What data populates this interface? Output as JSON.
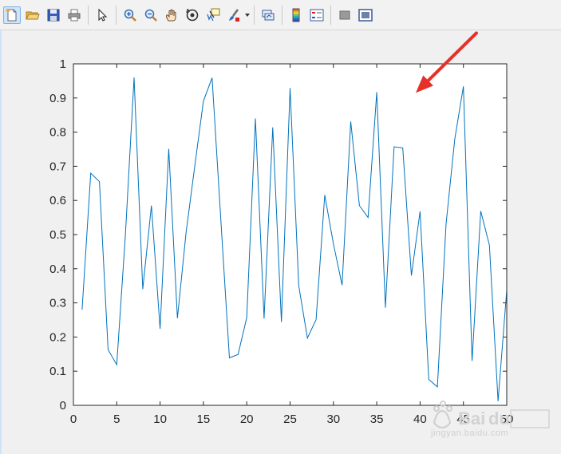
{
  "toolbar": {
    "buttons": [
      {
        "icon": "new-figure-icon"
      },
      {
        "icon": "open-file-icon"
      },
      {
        "icon": "save-icon"
      },
      {
        "icon": "print-icon"
      },
      {
        "icon": "edit-plot-arrow-icon"
      },
      {
        "icon": "zoom-in-icon"
      },
      {
        "icon": "zoom-out-icon"
      },
      {
        "icon": "pan-hand-icon"
      },
      {
        "icon": "rotate-3d-icon"
      },
      {
        "icon": "data-cursor-icon"
      },
      {
        "icon": "brush-icon"
      },
      {
        "icon": "link-plot-icon"
      },
      {
        "icon": "insert-colorbar-icon"
      },
      {
        "icon": "insert-legend-icon"
      },
      {
        "icon": "hide-plot-tools-icon"
      },
      {
        "icon": "show-plot-tools-icon"
      }
    ]
  },
  "colors": {
    "line": "#0072bd",
    "annotation_arrow": "#e8302a",
    "axes_background": "#ffffff",
    "figure_background": "#f0f0f0"
  },
  "chart_data": {
    "type": "line",
    "x": [
      1,
      2,
      3,
      4,
      5,
      6,
      7,
      8,
      9,
      10,
      11,
      12,
      13,
      14,
      15,
      16,
      17,
      18,
      19,
      20,
      21,
      22,
      23,
      24,
      25,
      26,
      27,
      28,
      29,
      30,
      31,
      32,
      33,
      34,
      35,
      36,
      37,
      38,
      39,
      40,
      41,
      42,
      43,
      44,
      45,
      46,
      47,
      48,
      49,
      50
    ],
    "series": [
      {
        "values": [
          0.28,
          0.68,
          0.655,
          0.163,
          0.119,
          0.5,
          0.96,
          0.34,
          0.585,
          0.224,
          0.751,
          0.255,
          0.506,
          0.7,
          0.891,
          0.959,
          0.547,
          0.139,
          0.149,
          0.257,
          0.84,
          0.254,
          0.814,
          0.244,
          0.929,
          0.35,
          0.197,
          0.251,
          0.616,
          0.473,
          0.352,
          0.831,
          0.585,
          0.55,
          0.917,
          0.286,
          0.757,
          0.754,
          0.38,
          0.568,
          0.076,
          0.054,
          0.531,
          0.779,
          0.934,
          0.13,
          0.569,
          0.469,
          0.012,
          0.337
        ]
      }
    ],
    "xlim": [
      0,
      50
    ],
    "ylim": [
      0,
      1
    ],
    "xticks": [
      0,
      5,
      10,
      15,
      20,
      25,
      30,
      35,
      40,
      45,
      50
    ],
    "yticks": [
      0,
      0.1,
      0.2,
      0.3,
      0.4,
      0.5,
      0.6,
      0.7,
      0.8,
      0.9,
      1
    ],
    "xtick_labels": [
      "0",
      "5",
      "10",
      "15",
      "20",
      "25",
      "30",
      "35",
      "40",
      "45",
      "50"
    ],
    "ytick_labels": [
      "0",
      "0.1",
      "0.2",
      "0.3",
      "0.4",
      "0.5",
      "0.6",
      "0.7",
      "0.8",
      "0.9",
      "1"
    ],
    "grid": false,
    "box": true,
    "annotation": {
      "type": "arrow",
      "from": [
        46.5,
        1.09
      ],
      "to": [
        39.5,
        0.915
      ]
    }
  },
  "watermark": {
    "site": "jingyan.baidu.com"
  }
}
